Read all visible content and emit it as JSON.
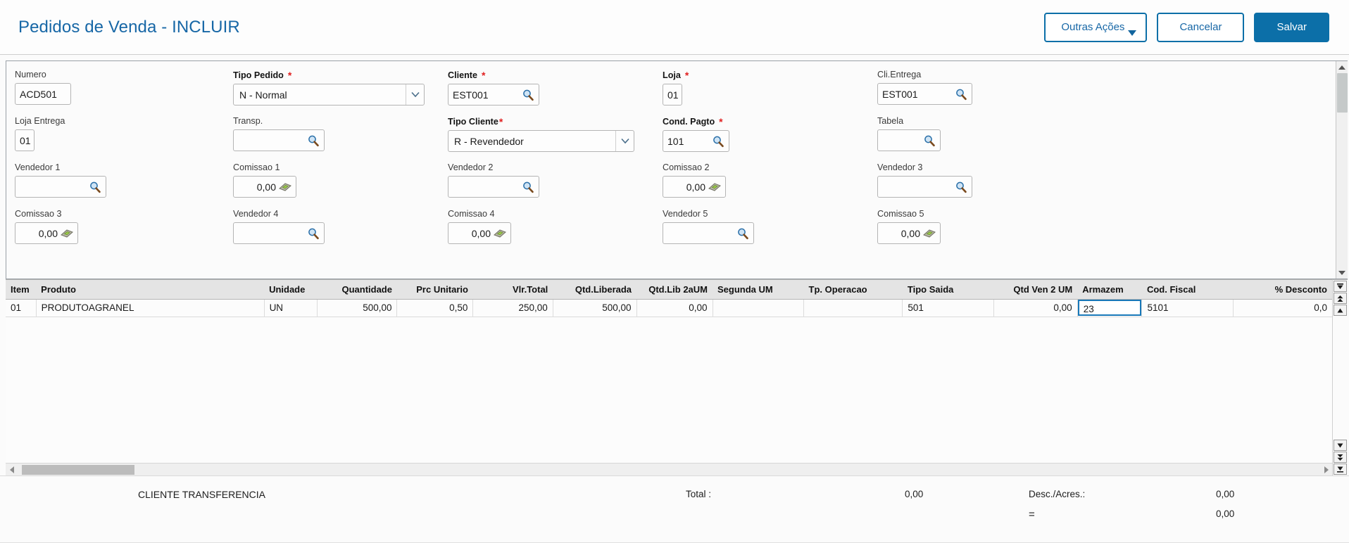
{
  "header": {
    "title": "Pedidos de Venda - INCLUIR",
    "buttons": {
      "other_actions": "Outras Ações",
      "cancel": "Cancelar",
      "save": "Salvar"
    },
    "accent_color": "#0c6fa8",
    "title_color": "#1767a6"
  },
  "form": {
    "rows": [
      {
        "fields": [
          {
            "label": "Numero",
            "value": "ACD501",
            "required": false,
            "type": "text",
            "icon": "none"
          },
          {
            "label": "Tipo Pedido",
            "value": "N - Normal",
            "required": true,
            "type": "select",
            "icon": "chevron-down-icon"
          },
          {
            "label": "Cliente",
            "value": "EST001",
            "required": true,
            "type": "lookup",
            "icon": "magnifier-icon"
          },
          {
            "label": "Loja",
            "value": "01",
            "required": true,
            "type": "text",
            "icon": "none"
          },
          {
            "label": "Cli.Entrega",
            "value": "EST001",
            "required": false,
            "type": "lookup",
            "icon": "magnifier-icon"
          }
        ]
      },
      {
        "fields": [
          {
            "label": "Loja Entrega",
            "value": "01",
            "required": false,
            "type": "text",
            "icon": "none"
          },
          {
            "label": "Transp.",
            "value": "",
            "required": false,
            "type": "lookup",
            "icon": "magnifier-icon"
          },
          {
            "label": "Tipo Cliente",
            "value": "R - Revendedor",
            "required": true,
            "type": "select",
            "icon": "chevron-down-icon"
          },
          {
            "label": "Cond. Pagto",
            "value": "101",
            "required": true,
            "type": "lookup",
            "icon": "magnifier-icon"
          },
          {
            "label": "Tabela",
            "value": "",
            "required": false,
            "type": "lookup",
            "icon": "magnifier-icon"
          }
        ]
      },
      {
        "fields": [
          {
            "label": "Vendedor 1",
            "value": "",
            "required": false,
            "type": "lookup",
            "icon": "magnifier-icon"
          },
          {
            "label": "Comissao 1",
            "value": "0,00",
            "required": false,
            "type": "money",
            "icon": "money-icon"
          },
          {
            "label": "Vendedor 2",
            "value": "",
            "required": false,
            "type": "lookup",
            "icon": "magnifier-icon"
          },
          {
            "label": "Comissao 2",
            "value": "0,00",
            "required": false,
            "type": "money",
            "icon": "money-icon"
          },
          {
            "label": "Vendedor 3",
            "value": "",
            "required": false,
            "type": "lookup",
            "icon": "magnifier-icon"
          }
        ]
      },
      {
        "fields": [
          {
            "label": "Comissao 3",
            "value": "0,00",
            "required": false,
            "type": "money",
            "icon": "money-icon"
          },
          {
            "label": "Vendedor 4",
            "value": "",
            "required": false,
            "type": "lookup",
            "icon": "magnifier-icon"
          },
          {
            "label": "Comissao 4",
            "value": "0,00",
            "required": false,
            "type": "money",
            "icon": "money-icon"
          },
          {
            "label": "Vendedor 5",
            "value": "",
            "required": false,
            "type": "lookup",
            "icon": "magnifier-icon"
          },
          {
            "label": "Comissao 5",
            "value": "0,00",
            "required": false,
            "type": "money",
            "icon": "money-icon"
          }
        ]
      }
    ]
  },
  "grid": {
    "columns": [
      {
        "label": "Item",
        "align": "left"
      },
      {
        "label": "Produto",
        "align": "left"
      },
      {
        "label": "Unidade",
        "align": "left"
      },
      {
        "label": "Quantidade",
        "align": "right"
      },
      {
        "label": "Prc Unitario",
        "align": "right"
      },
      {
        "label": "Vlr.Total",
        "align": "right"
      },
      {
        "label": "Qtd.Liberada",
        "align": "right"
      },
      {
        "label": "Qtd.Lib 2aUM",
        "align": "right"
      },
      {
        "label": "Segunda UM",
        "align": "left"
      },
      {
        "label": "Tp. Operacao",
        "align": "left"
      },
      {
        "label": "Tipo Saida",
        "align": "left"
      },
      {
        "label": "Qtd Ven 2 UM",
        "align": "right"
      },
      {
        "label": "Armazem",
        "align": "left"
      },
      {
        "label": "Cod. Fiscal",
        "align": "left"
      },
      {
        "label": "% Desconto",
        "align": "right"
      }
    ],
    "rows": [
      {
        "item": "01",
        "produto": "PRODUTOAGRANEL",
        "unidade": "UN",
        "quantidade": "500,00",
        "prc_unitario": "0,50",
        "vlr_total": "250,00",
        "qtd_liberada": "500,00",
        "qtd_lib_2aum": "0,00",
        "segunda_um": "",
        "tp_operacao": "",
        "tipo_saida": "501",
        "qtd_ven_2_um": "0,00",
        "armazem": "23",
        "cod_fiscal": "5101",
        "pct_desconto": "0,0"
      }
    ],
    "selected_cell": {
      "column": "Armazem",
      "value": "23",
      "border_color": "#1878b9"
    }
  },
  "totals": {
    "client_note": "CLIENTE TRANSFERENCIA",
    "total_label": "Total :",
    "total_value": "0,00",
    "disc_label": "Desc./Acres.:",
    "disc_value": "0,00",
    "equals_label": "=",
    "equals_value": "0,00"
  }
}
